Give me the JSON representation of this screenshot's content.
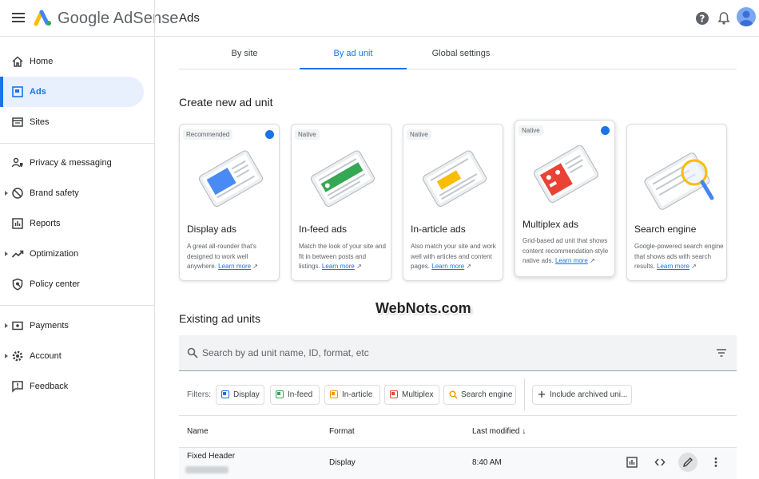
{
  "app": {
    "brand": "Google AdSense",
    "page_title": "Ads"
  },
  "sidebar": {
    "items": [
      {
        "label": "Home",
        "icon": "home-icon"
      },
      {
        "label": "Ads",
        "icon": "ads-icon",
        "active": true
      },
      {
        "label": "Sites",
        "icon": "sites-icon"
      },
      {
        "label": "Privacy & messaging",
        "icon": "privacy-icon"
      },
      {
        "label": "Brand safety",
        "icon": "brand-safety-icon"
      },
      {
        "label": "Reports",
        "icon": "reports-icon"
      },
      {
        "label": "Optimization",
        "icon": "optimization-icon"
      },
      {
        "label": "Policy center",
        "icon": "policy-icon"
      },
      {
        "label": "Payments",
        "icon": "payments-icon"
      },
      {
        "label": "Account",
        "icon": "account-icon"
      },
      {
        "label": "Feedback",
        "icon": "feedback-icon"
      }
    ]
  },
  "tabs": [
    {
      "label": "By site"
    },
    {
      "label": "By ad unit",
      "active": true
    },
    {
      "label": "Global settings"
    }
  ],
  "create": {
    "title": "Create new ad unit",
    "cards": [
      {
        "badge": "Recommended",
        "title": "Display ads",
        "desc": "A great all-rounder that's designed to work well anywhere.",
        "link": "Learn more"
      },
      {
        "badge": "Native",
        "title": "In-feed ads",
        "desc": "Match the look of your site and fit in between posts and listings.",
        "link": "Learn more"
      },
      {
        "badge": "Native",
        "title": "In-article ads",
        "desc": "Also match your site and work well with articles and content pages.",
        "link": "Learn more"
      },
      {
        "badge": "Native",
        "title": "Multiplex ads",
        "desc": "Grid-based ad unit that shows content recommendation-style native ads.",
        "link": "Learn more"
      },
      {
        "badge": "",
        "title": "Search engine",
        "desc": "Google-powered search engine that shows ads with search results.",
        "link": "Learn more"
      }
    ]
  },
  "existing": {
    "title": "Existing ad units",
    "search_placeholder": "Search by ad unit name, ID, format, etc",
    "filters_label": "Filters:",
    "chips": [
      "Display",
      "In-feed",
      "In-article",
      "Multiplex",
      "Search engine",
      "Include archived uni..."
    ],
    "columns": {
      "name": "Name",
      "format": "Format",
      "modified": "Last modified ↓"
    },
    "rows": [
      {
        "name": "Fixed Header",
        "format": "Display",
        "modified": "8:40 AM"
      }
    ]
  },
  "watermark": "WebNots.com",
  "colors": {
    "accent": "#1a73e8",
    "active_bg": "#e8f0fe"
  }
}
